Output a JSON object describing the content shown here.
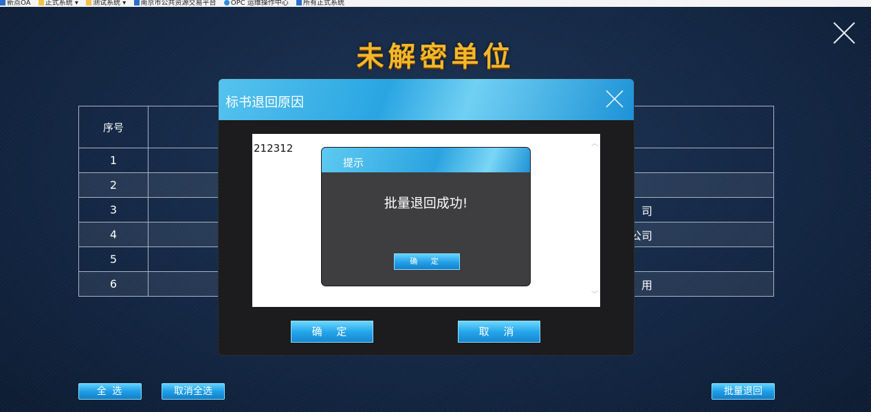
{
  "bookmarks": [
    {
      "label": "新点OA",
      "icon": "page-icon"
    },
    {
      "label": "正式系统 ▾",
      "icon": "folder-icon"
    },
    {
      "label": "测试系统 ▾",
      "icon": "folder-icon"
    },
    {
      "label": "南京市公共资源交易平台",
      "icon": "page-icon"
    },
    {
      "label": "OPC 运维操作中心",
      "icon": "circle-icon"
    },
    {
      "label": "所有正式系统",
      "icon": "page-icon"
    }
  ],
  "page": {
    "title": "未解密单位",
    "close_icon": "close-icon"
  },
  "table": {
    "header_index": "序号",
    "rows": [
      {
        "index": "1",
        "name": ""
      },
      {
        "index": "2",
        "name": ""
      },
      {
        "index": "3",
        "name": "司"
      },
      {
        "index": "4",
        "name": "公司"
      },
      {
        "index": "5",
        "name": ""
      },
      {
        "index": "6",
        "name": "用"
      }
    ]
  },
  "footer": {
    "select_all": "全 选",
    "deselect_all": "取消全选",
    "batch_return": "批量退回"
  },
  "dialog": {
    "title": "标书退回原因",
    "reason_text": "212312",
    "confirm": "确 定",
    "cancel": "取 消"
  },
  "tip": {
    "title": "提示",
    "message": "批量退回成功!",
    "ok": "确 定"
  },
  "colors": {
    "title_gold": "#f4b729",
    "accent_blue": "#1f9ee6",
    "background": "#132744"
  }
}
